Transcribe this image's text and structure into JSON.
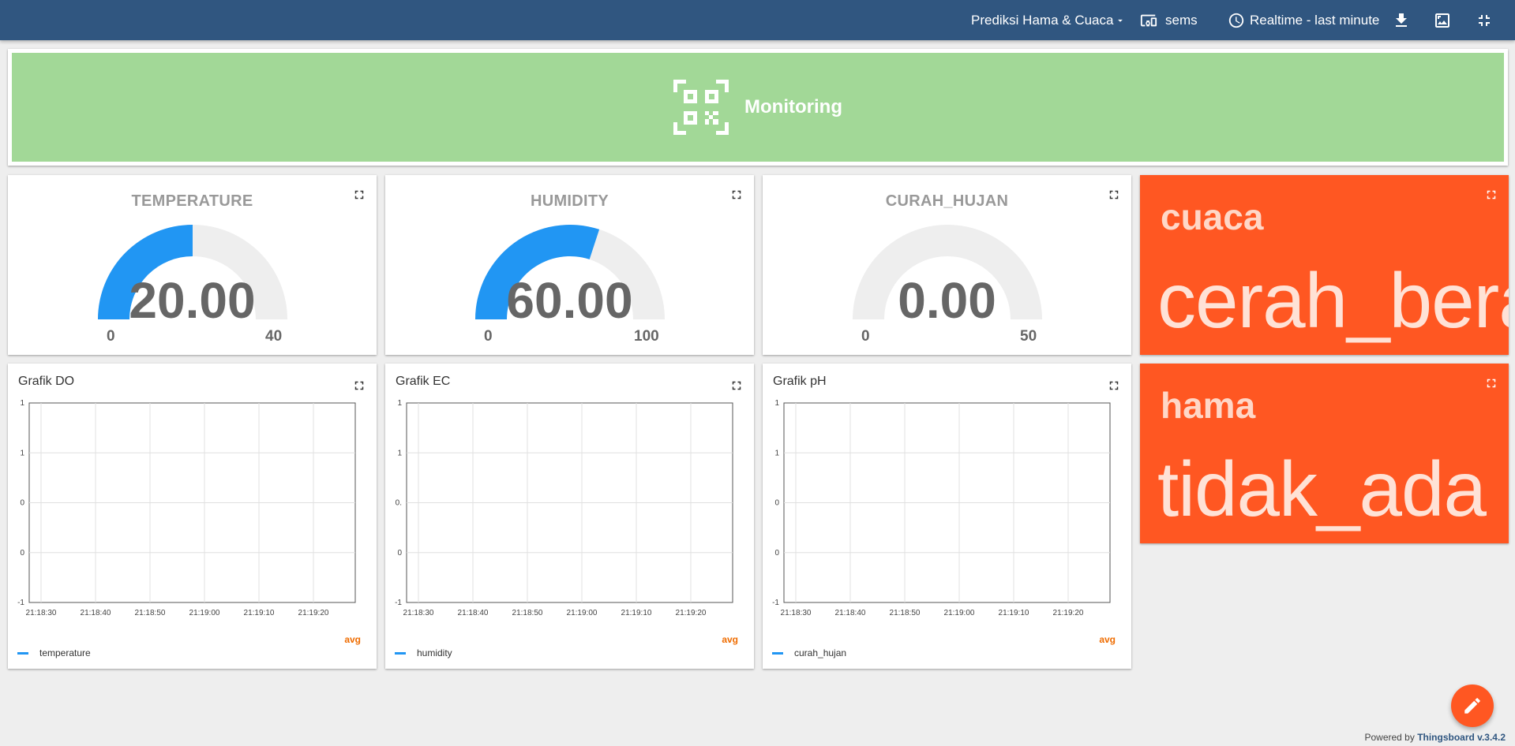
{
  "toolbar": {
    "dashboard_name": "Prediksi Hama & Cuaca",
    "device": "sems",
    "timewindow": "Realtime - last minute",
    "icons": [
      "chevron-down-icon",
      "device-icon",
      "clock-icon",
      "download-icon",
      "image-export-icon",
      "exit-fullscreen-icon"
    ]
  },
  "banner": {
    "title": "Monitoring",
    "icon": "qr-code-icon",
    "color": "#a2d897"
  },
  "gauges": [
    {
      "title": "TEMPERATURE",
      "value": "20.00",
      "min": "0",
      "max": "40",
      "ratio": 0.5
    },
    {
      "title": "HUMIDITY",
      "value": "60.00",
      "min": "0",
      "max": "100",
      "ratio": 0.6
    },
    {
      "title": "CURAH_HUJAN",
      "value": "0.00",
      "min": "0",
      "max": "50",
      "ratio": 0.0
    }
  ],
  "value_cards": [
    {
      "label": "cuaca",
      "value": "cerah_bera"
    },
    {
      "label": "hama",
      "value": "tidak_ada"
    }
  ],
  "charts": [
    {
      "title": "Grafik DO",
      "legend": "temperature",
      "avg_label": "avg"
    },
    {
      "title": "Grafik EC",
      "legend": "humidity",
      "avg_label": "avg"
    },
    {
      "title": "Grafik pH",
      "legend": "curah_hujan",
      "avg_label": "avg"
    }
  ],
  "chart_data": [
    {
      "type": "line",
      "title": "Grafik DO",
      "x": [
        "21:18:30",
        "21:18:40",
        "21:18:50",
        "21:19:00",
        "21:19:10",
        "21:19:20"
      ],
      "y_ticks": [
        "1",
        "1",
        "0",
        "0",
        "-1"
      ],
      "series": [
        {
          "name": "temperature",
          "values": []
        }
      ]
    },
    {
      "type": "line",
      "title": "Grafik EC",
      "x": [
        "21:18:30",
        "21:18:40",
        "21:18:50",
        "21:19:00",
        "21:19:10",
        "21:19:20"
      ],
      "y_ticks": [
        "1",
        "1",
        "0.",
        "0",
        "-1"
      ],
      "series": [
        {
          "name": "humidity",
          "values": []
        }
      ]
    },
    {
      "type": "line",
      "title": "Grafik pH",
      "x": [
        "21:18:30",
        "21:18:40",
        "21:18:50",
        "21:19:00",
        "21:19:10",
        "21:19:20"
      ],
      "y_ticks": [
        "1",
        "1",
        "0",
        "0",
        "-1"
      ],
      "series": [
        {
          "name": "curah_hujan",
          "values": []
        }
      ]
    }
  ],
  "footer": {
    "prefix": "Powered by",
    "brand": "Thingsboard v.3.4.2"
  },
  "colors": {
    "toolbar": "#305680",
    "gauge_fill": "#2196f3",
    "gauge_track": "#eeeeee",
    "value_card": "#ff5722",
    "fab": "#ff5722"
  }
}
